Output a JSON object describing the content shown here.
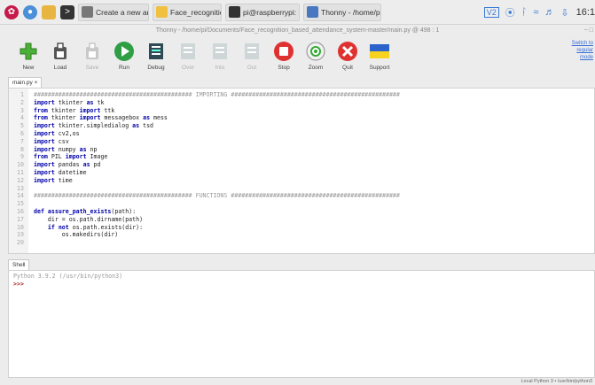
{
  "taskbar": {
    "tasks": [
      {
        "label": "Create a new archive",
        "color": "#777777"
      },
      {
        "label": "Face_recognition_ba...",
        "color": "#f0c040"
      },
      {
        "label": "pi@raspberrypi: ~",
        "color": "#333333"
      },
      {
        "label": "Thonny - /home/pi/...",
        "color": "#4a78c0"
      }
    ],
    "clock": "16:1"
  },
  "window": {
    "title": "Thonny - /home/pi/Documents/Face_recognition_based_attendance_system-master/main.py @ 498 : 1",
    "controls": "− □"
  },
  "toolbar": {
    "buttons": [
      {
        "label": "New",
        "icon": "plus-icon",
        "enabled": true
      },
      {
        "label": "Load",
        "icon": "load-icon",
        "enabled": true
      },
      {
        "label": "Save",
        "icon": "save-icon",
        "enabled": false
      },
      {
        "label": "Run",
        "icon": "run-icon",
        "enabled": true
      },
      {
        "label": "Debug",
        "icon": "debug-icon",
        "enabled": true
      },
      {
        "label": "Over",
        "icon": "step-over-icon",
        "enabled": false
      },
      {
        "label": "Into",
        "icon": "step-into-icon",
        "enabled": false
      },
      {
        "label": "Out",
        "icon": "step-out-icon",
        "enabled": false
      },
      {
        "label": "Stop",
        "icon": "stop-icon",
        "enabled": true
      },
      {
        "label": "Zoom",
        "icon": "zoom-icon",
        "enabled": true
      },
      {
        "label": "Quit",
        "icon": "quit-icon",
        "enabled": true
      },
      {
        "label": "Support",
        "icon": "support-flag-icon",
        "enabled": true
      }
    ],
    "switch_link": "Switch to regular mode"
  },
  "editor": {
    "tab_label": "main.py ×",
    "lines": [
      {
        "n": "1",
        "text": "############################################# IMPORTING ################################################",
        "type": "comment"
      },
      {
        "n": "2",
        "text": "import tkinter as tk",
        "type": "code"
      },
      {
        "n": "3",
        "text": "from tkinter import ttk",
        "type": "code"
      },
      {
        "n": "4",
        "text": "from tkinter import messagebox as mess",
        "type": "code"
      },
      {
        "n": "5",
        "text": "import tkinter.simpledialog as tsd",
        "type": "code"
      },
      {
        "n": "6",
        "text": "import cv2,os",
        "type": "code"
      },
      {
        "n": "7",
        "text": "import csv",
        "type": "code"
      },
      {
        "n": "8",
        "text": "import numpy as np",
        "type": "code"
      },
      {
        "n": "9",
        "text": "from PIL import Image",
        "type": "code"
      },
      {
        "n": "10",
        "text": "import pandas as pd",
        "type": "code"
      },
      {
        "n": "11",
        "text": "import datetime",
        "type": "code"
      },
      {
        "n": "12",
        "text": "import time",
        "type": "code"
      },
      {
        "n": "13",
        "text": "",
        "type": "code"
      },
      {
        "n": "14",
        "text": "############################################# FUNCTIONS ################################################",
        "type": "comment"
      },
      {
        "n": "15",
        "text": "",
        "type": "code"
      },
      {
        "n": "16",
        "text": "def assure_path_exists(path):",
        "type": "code"
      },
      {
        "n": "17",
        "text": "    dir = os.path.dirname(path)",
        "type": "code"
      },
      {
        "n": "18",
        "text": "    if not os.path.exists(dir):",
        "type": "code"
      },
      {
        "n": "19",
        "text": "        os.makedirs(dir)",
        "type": "code"
      },
      {
        "n": "20",
        "text": "",
        "type": "code"
      }
    ]
  },
  "shell": {
    "tab_label": "Shell",
    "version_line": "Python 3.9.2 (/usr/bin/python3)",
    "prompt": ">>>"
  },
  "statusbar": {
    "text": "Local Python 3 • /usr/bin/python3"
  }
}
